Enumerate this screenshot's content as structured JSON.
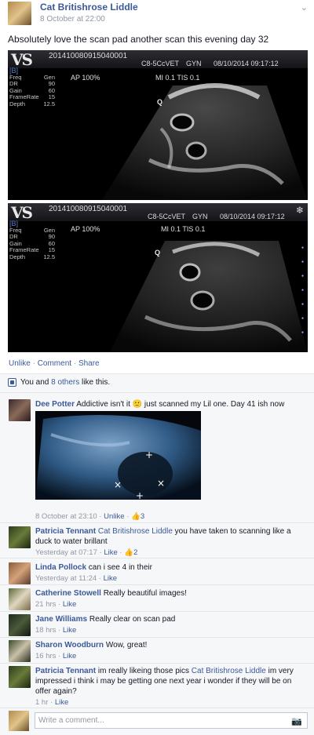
{
  "post": {
    "author": "Cat Britishrose Liddle",
    "time": "8 October at 22:00",
    "text": "Absolutely love the scan pad another scan this evening day 32"
  },
  "scans": [
    {
      "id": "201410080915040001",
      "probe": "C8-5CcVET",
      "preset": "GYN",
      "datetime": "08/10/2014 09:17:12",
      "ap": "AP 100%",
      "mi": "MI 0.1 TIS 0.1",
      "mode": "[B]",
      "params": [
        [
          "Freq",
          "Gen"
        ],
        [
          "DR",
          "90"
        ],
        [
          "Gain",
          "60"
        ],
        [
          "FrameRate",
          "15"
        ],
        [
          "Depth",
          "12.5"
        ]
      ],
      "q": "Q"
    },
    {
      "id": "201410080915040001",
      "probe": "C8-5CcVET",
      "preset": "GYN",
      "datetime": "08/10/2014 09:17:12",
      "ap": "AP 100%",
      "mi": "MI 0.1 TIS 0.1",
      "mode": "[B]",
      "params": [
        [
          "Freq",
          "Gen"
        ],
        [
          "DR",
          "90"
        ],
        [
          "Gain",
          "60"
        ],
        [
          "FrameRate",
          "15"
        ],
        [
          "Depth",
          "12.5"
        ]
      ],
      "q": "Q"
    }
  ],
  "actions": {
    "unlike": "Unlike",
    "comment": "Comment",
    "share": "Share",
    "sep": " · "
  },
  "likes": {
    "prefix": "You and ",
    "others": "8 others",
    "suffix": " like this."
  },
  "comments": [
    {
      "name": "Dee Potter",
      "text": "Addictive isn't it 🙂 just scanned my Lil one. Day 41 ish now",
      "time": "8 October at 23:10",
      "like_label": "Unlike",
      "like_count": "3"
    },
    {
      "name": "Patricia Tennant",
      "mention": "Cat Britishrose Liddle",
      "text": " you have taken to scanning like a duck to water brillant",
      "time": "Yesterday at 07:17",
      "like_label": "Like",
      "like_count": "2"
    },
    {
      "name": "Linda Pollock",
      "text": "can i see 4 in their",
      "time": "Yesterday at 11:24",
      "like_label": "Like"
    },
    {
      "name": "Catherine Stowell",
      "text": "Really beautiful images!",
      "time": "21 hrs",
      "like_label": "Like"
    },
    {
      "name": "Jane Williams",
      "text": "Really clear on scan pad",
      "time": "18 hrs",
      "like_label": "Like"
    },
    {
      "name": "Sharon Woodburn",
      "text": "Wow, great!",
      "time": "16 hrs",
      "like_label": "Like"
    },
    {
      "name": "Patricia Tennant",
      "text_before": "im really likeing those pics ",
      "mention": "Cat Britishrose Liddle",
      "text": " im very impressed i think i may be getting one next year i wonder if they will be on offer again?",
      "time": "1 hr",
      "like_label": "Like"
    }
  ],
  "composer": {
    "placeholder": "Write a comment..."
  },
  "icons": {
    "chevron": "chevron-down-icon",
    "thumb": "thumbs-up-icon",
    "camera": "camera-icon",
    "snowflake": "snowflake-icon",
    "smiley": "smiley-icon"
  },
  "colors": {
    "link": "#3b5998",
    "meta": "#9197a3",
    "panel": "#f6f7f9"
  }
}
